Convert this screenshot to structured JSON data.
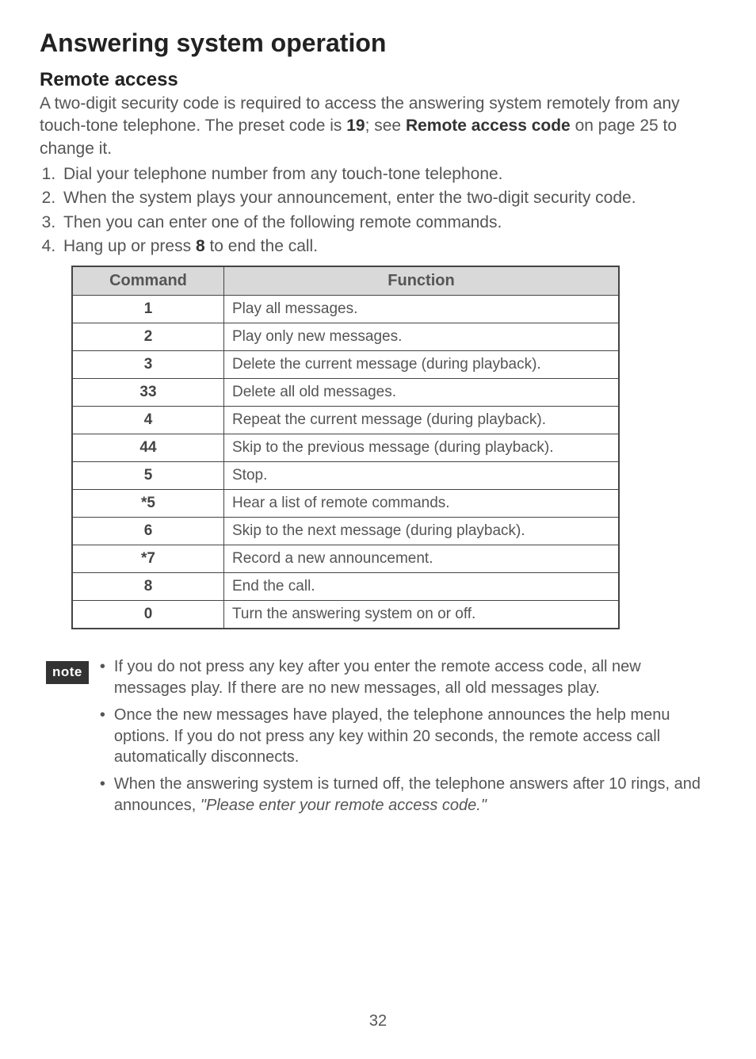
{
  "title": "Answering system operation",
  "subtitle": "Remote access",
  "intro": {
    "part1": "A two-digit security code is required to access the answering system remotely from any touch-tone telephone. The preset code is ",
    "preset_code": "19",
    "part2": "; see ",
    "ref": "Remote access code",
    "part3": " on page 25 to change it."
  },
  "steps": {
    "s1": "Dial your telephone number from any touch-tone telephone.",
    "s2": "When the system plays your announcement, enter the two-digit security code.",
    "s3": "Then you can enter one of the following remote commands.",
    "s4a": "Hang up or press ",
    "s4key": "8",
    "s4b": " to end the call."
  },
  "table": {
    "head_cmd": "Command",
    "head_fn": "Function",
    "rows": [
      {
        "cmd": "1",
        "fn": "Play all messages."
      },
      {
        "cmd": "2",
        "fn": "Play only new messages."
      },
      {
        "cmd": "3",
        "fn": "Delete the current message (during playback)."
      },
      {
        "cmd": "33",
        "fn": "Delete all old messages."
      },
      {
        "cmd": "4",
        "fn": "Repeat the current message (during playback)."
      },
      {
        "cmd": "44",
        "fn": "Skip to the previous message (during playback)."
      },
      {
        "cmd": "5",
        "fn": "Stop."
      },
      {
        "cmd": "*5",
        "fn": "Hear a list of remote commands."
      },
      {
        "cmd": "6",
        "fn": "Skip to the next message (during playback)."
      },
      {
        "cmd": "*7",
        "fn": "Record a new announcement."
      },
      {
        "cmd": "8",
        "fn": "End the call."
      },
      {
        "cmd": "0",
        "fn": "Turn the answering system on or off."
      }
    ]
  },
  "note_label": "note",
  "notes": {
    "n1": "If you do not press any key after you enter the remote access code, all new messages play. If there are no new messages, all old messages play.",
    "n2": "Once the new messages have played, the telephone announces the help menu options. If you do not press any key within 20 seconds, the remote access call automatically disconnects.",
    "n3a": "When the answering system is turned off, the telephone answers after 10 rings, and announces, ",
    "n3quote": "\"Please enter your remote access code.\""
  },
  "page_number": "32"
}
